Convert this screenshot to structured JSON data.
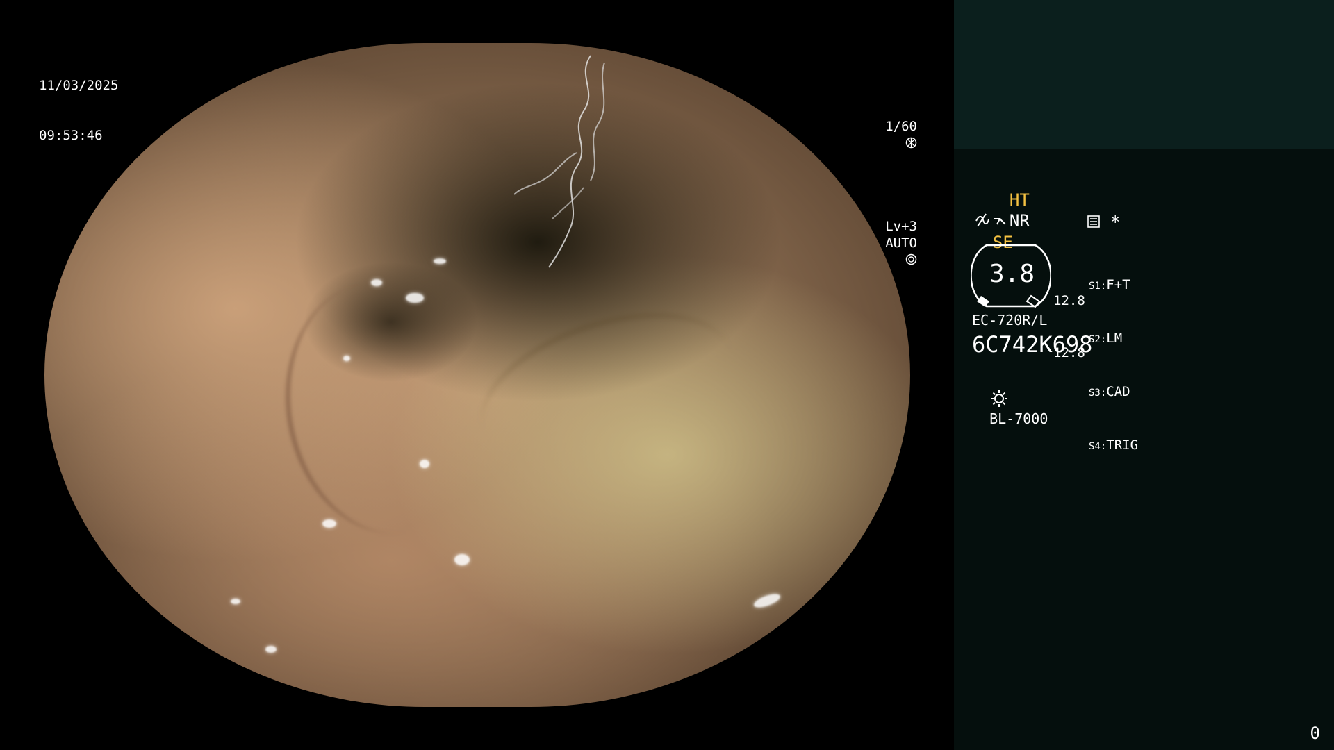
{
  "datetime": {
    "date": "11/03/2025",
    "time": "09:53:46"
  },
  "exposure": {
    "shutter": "1/60",
    "level": "Lv+3",
    "iris_mode": "AUTO",
    "shutter_icon": "aperture-icon",
    "iris_icon": "iris-icon"
  },
  "panel": {
    "modes": {
      "ht": "HT",
      "nr": "NR",
      "se": "SE",
      "se_icon": "hand-mode-icon",
      "enh_icon": "enhancement-icon",
      "memory_icon": "memory-card-icon",
      "star": "*"
    },
    "gauge": {
      "value": "3.8",
      "right_values": [
        "12.8",
        "12.8"
      ]
    },
    "switches": [
      {
        "key": "S1:",
        "value": "F+T"
      },
      {
        "key": "S2:",
        "value": "LM"
      },
      {
        "key": "S3:",
        "value": "CAD"
      },
      {
        "key": "S4:",
        "value": "TRIG"
      }
    ],
    "scope_model": "EC-720R/L",
    "serial": "6C742K698",
    "light_source": "BL-7000",
    "light_icon": "lamp-sun-icon"
  },
  "frame_counter": "0",
  "colors": {
    "accent": "#f5c242",
    "panel_bg": "#050f0d",
    "panel_top": "#0b1f1d"
  }
}
